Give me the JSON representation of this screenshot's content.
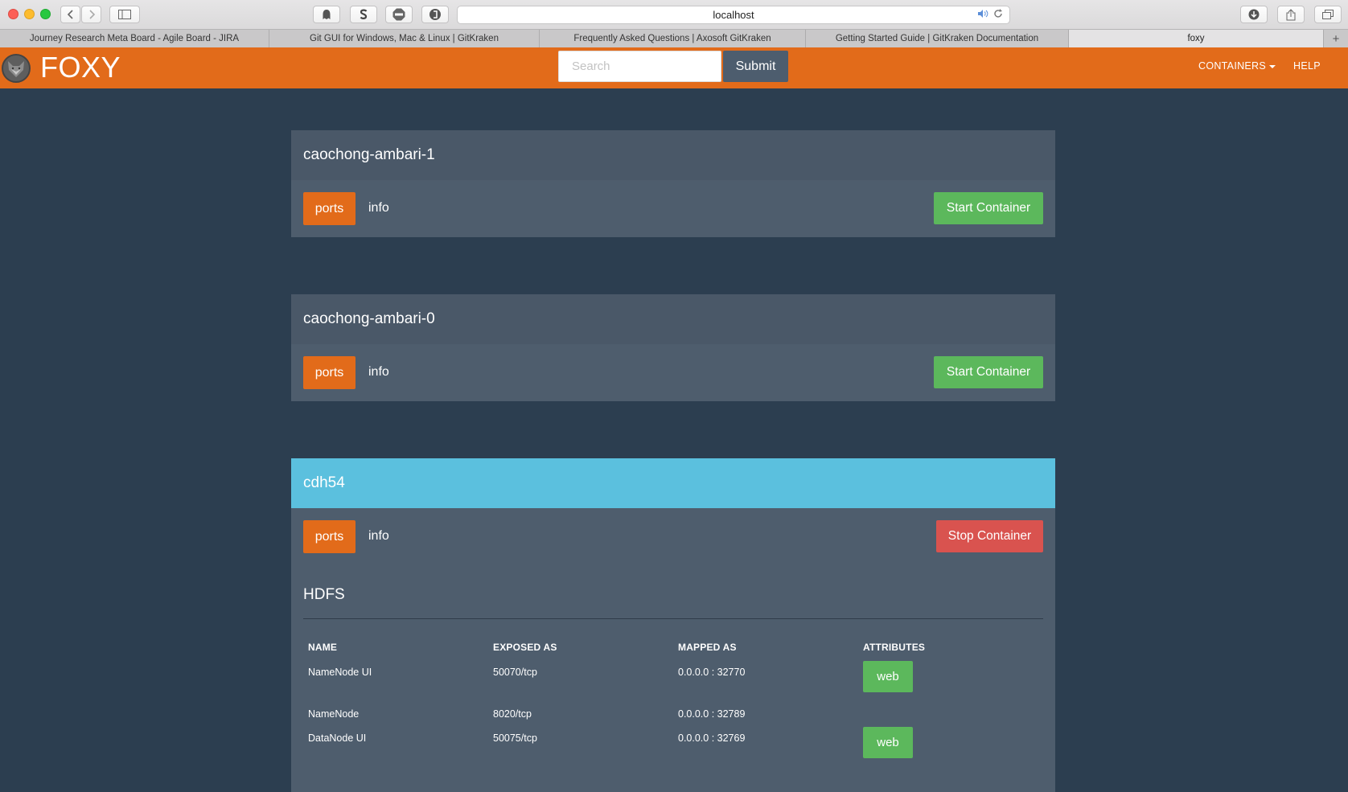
{
  "browser": {
    "address": "localhost",
    "tabs": [
      {
        "label": "Journey Research Meta Board - Agile Board - JIRA"
      },
      {
        "label": "Git GUI for Windows, Mac & Linux | GitKraken"
      },
      {
        "label": "Frequently Asked Questions | Axosoft GitKraken"
      },
      {
        "label": "Getting Started Guide | GitKraken Documentation"
      },
      {
        "label": "foxy"
      }
    ],
    "toolbar_icons": [
      "back-icon",
      "forward-icon",
      "sidebar-icon",
      "ghostery-icon",
      "skype-icon",
      "adblock-icon",
      "extension-icon",
      "download-icon",
      "share-icon",
      "tabs-icon"
    ]
  },
  "app": {
    "brand": "FOXY",
    "search_placeholder": "Search",
    "submit_label": "Submit",
    "nav": {
      "containers": "CONTAINERS",
      "help": "HELP"
    }
  },
  "containers": [
    {
      "name": "caochong-ambari-1",
      "ports_tab": "ports",
      "info_tab": "info",
      "action": "Start Container",
      "active": false
    },
    {
      "name": "caochong-ambari-0",
      "ports_tab": "ports",
      "info_tab": "info",
      "action": "Start Container",
      "active": false
    },
    {
      "name": "cdh54",
      "ports_tab": "ports",
      "info_tab": "info",
      "action": "Stop Container",
      "active": true,
      "section": "HDFS",
      "columns": [
        "NAME",
        "EXPOSED AS",
        "MAPPED AS",
        "ATTRIBUTES"
      ],
      "rows": [
        {
          "name": "NameNode UI",
          "exposed": "50070/tcp",
          "mapped": "0.0.0.0 : 32770",
          "attribute": "web"
        },
        {
          "name": "NameNode",
          "exposed": "8020/tcp",
          "mapped": "0.0.0.0 : 32789",
          "attribute": ""
        },
        {
          "name": "DataNode UI",
          "exposed": "50075/tcp",
          "mapped": "0.0.0.0 : 32769",
          "attribute": "web"
        }
      ]
    }
  ],
  "colors": {
    "navbar": "#e26b1a",
    "background": "#2c3e50",
    "panel_head": "#4a5868",
    "active_head": "#5bc0de",
    "start": "#5cb85c",
    "stop": "#d9534f"
  }
}
